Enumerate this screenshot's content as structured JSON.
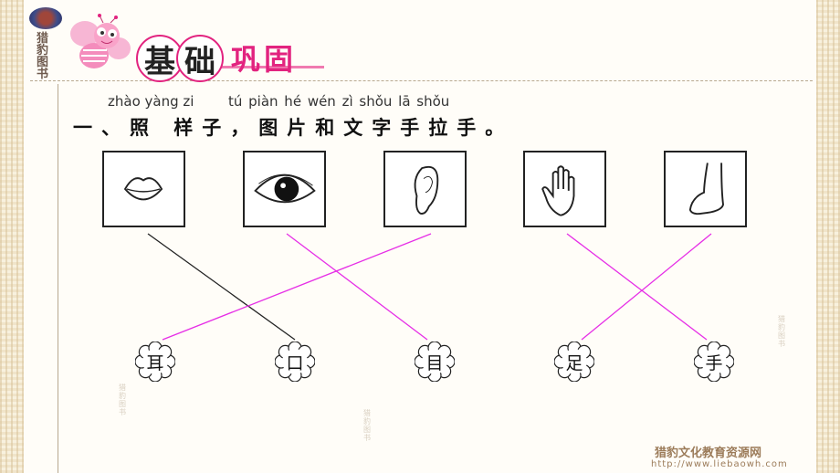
{
  "brand": {
    "vertical_text": "猎豹图书"
  },
  "section": {
    "title_circled": [
      "基",
      "础"
    ],
    "title_rest": "巩固"
  },
  "question": {
    "pinyin": [
      "zhào yàng zi",
      "tú piàn hé wén zì shǒu lā shǒu"
    ],
    "text": "一、照 样子，图片和文字手拉手。"
  },
  "pictures": [
    {
      "icon": "mouth-icon"
    },
    {
      "icon": "eye-icon"
    },
    {
      "icon": "ear-icon"
    },
    {
      "icon": "hand-icon"
    },
    {
      "icon": "foot-icon"
    }
  ],
  "words": [
    "耳",
    "口",
    "目",
    "足",
    "手"
  ],
  "connections": [
    {
      "picture": 0,
      "word": 1,
      "color": "#222222",
      "example": true
    },
    {
      "picture": 2,
      "word": 0,
      "color": "#e62ee6"
    },
    {
      "picture": 1,
      "word": 2,
      "color": "#e62ee6"
    },
    {
      "picture": 3,
      "word": 4,
      "color": "#e62ee6"
    },
    {
      "picture": 4,
      "word": 3,
      "color": "#e62ee6"
    }
  ],
  "footer": {
    "publisher": "猎豹文化教育资源网",
    "url": "http://www.liebaowh.com"
  },
  "watermark": "猎豹图书",
  "colors": {
    "accent": "#e2237f",
    "answer_line": "#e62ee6"
  }
}
